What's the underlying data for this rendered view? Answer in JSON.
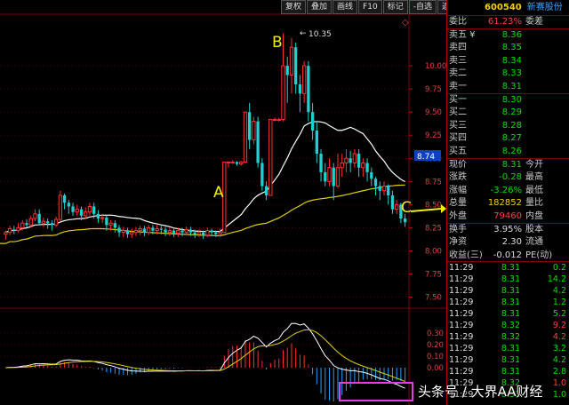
{
  "toolbar": {
    "buttons": [
      "复权",
      "叠加",
      "画线",
      "F10",
      "标记",
      "-自选",
      "返回"
    ],
    "close_symbol": "◇"
  },
  "stock": {
    "code": "600540",
    "name": "新赛股份"
  },
  "annotations": {
    "peak_price": "10.35",
    "label_a": "A",
    "label_b": "B",
    "label_c": "C",
    "current_price_tag": "8.74"
  },
  "price_axis": {
    "ticks": [
      "10.00",
      "9.75",
      "9.50",
      "9.25",
      "9.00",
      "8.75",
      "8.50",
      "8.25",
      "8.00",
      "7.75",
      "7.50"
    ]
  },
  "macd_axis": {
    "ticks": [
      "0.30",
      "0.20",
      "0.10",
      "0.00"
    ]
  },
  "order_book": {
    "ratio_label": "委比",
    "ratio_value": "61.23%",
    "diff_label": "委差",
    "asks": [
      {
        "label": "卖五 ¥",
        "price": "8.36"
      },
      {
        "label": "卖四",
        "price": "8.35"
      },
      {
        "label": "卖三",
        "price": "8.34"
      },
      {
        "label": "卖二",
        "price": "8.33"
      },
      {
        "label": "卖一",
        "price": "8.31"
      }
    ],
    "bids": [
      {
        "label": "买一",
        "price": "8.30"
      },
      {
        "label": "买二",
        "price": "8.29"
      },
      {
        "label": "买三",
        "price": "8.28"
      },
      {
        "label": "买四",
        "price": "8.27"
      },
      {
        "label": "买五",
        "price": "8.26"
      }
    ]
  },
  "quote": [
    {
      "label": "现价",
      "value": "8.31",
      "color": "green",
      "extra": "今开"
    },
    {
      "label": "涨跌",
      "value": "-0.28",
      "color": "green",
      "extra": "最高"
    },
    {
      "label": "涨幅",
      "value": "-3.26%",
      "color": "green",
      "extra": "最低"
    },
    {
      "label": "总量",
      "value": "182852",
      "color": "yellow",
      "extra": "量比"
    },
    {
      "label": "外盘",
      "value": "79460",
      "color": "red",
      "extra": "内盘"
    }
  ],
  "fundamentals": [
    {
      "label": "换手",
      "value": "3.95%",
      "extra": "股本"
    },
    {
      "label": "净资",
      "value": "2.30",
      "extra": "流通"
    },
    {
      "label": "收益(三)",
      "value": "-0.012",
      "extra": "PE(动)"
    }
  ],
  "ticks": [
    {
      "time": "11:29",
      "price": "8.31",
      "pcolor": "green",
      "vol": "0.2",
      "vcolor": "green"
    },
    {
      "time": "11:29",
      "price": "8.31",
      "pcolor": "green",
      "vol": "14.2",
      "vcolor": "green"
    },
    {
      "time": "11:29",
      "price": "8.31",
      "pcolor": "green",
      "vol": "4.2",
      "vcolor": "green"
    },
    {
      "time": "11:29",
      "price": "8.31",
      "pcolor": "green",
      "vol": "1.2",
      "vcolor": "green"
    },
    {
      "time": "11:29",
      "price": "8.31",
      "pcolor": "green",
      "vol": "5.2",
      "vcolor": "green"
    },
    {
      "time": "11:29",
      "price": "8.32",
      "pcolor": "green",
      "vol": "9.2",
      "vcolor": "red"
    },
    {
      "time": "11:29",
      "price": "8.32",
      "pcolor": "green",
      "vol": "4.2",
      "vcolor": "red"
    },
    {
      "time": "11:29",
      "price": "8.31",
      "pcolor": "green",
      "vol": "3.2",
      "vcolor": "green"
    },
    {
      "time": "11:29",
      "price": "8.31",
      "pcolor": "green",
      "vol": "4.2",
      "vcolor": "green"
    },
    {
      "time": "11:29",
      "price": "8.31",
      "pcolor": "green",
      "vol": "2.8",
      "vcolor": "green"
    },
    {
      "time": "11:29",
      "price": "8.32",
      "pcolor": "green",
      "vol": "1.0",
      "vcolor": "red"
    },
    {
      "time": "11:29",
      "price": "8.31",
      "pcolor": "green",
      "vol": "1.0",
      "vcolor": "green"
    }
  ],
  "watermark": "头条号 / 大界AA财经",
  "colors": {
    "up": "#ff3030",
    "down": "#20d0d0",
    "ma_short": "#ffffff",
    "ma_long": "#e0d000",
    "macd_up": "#ff3030",
    "macd_down": "#20a0ff",
    "highlight_box": "#e040e0",
    "grid": "#7a0000"
  },
  "chart_data": {
    "type": "candlestick",
    "ylim": [
      7.4,
      10.5
    ],
    "candles": [
      [
        8.18,
        8.2,
        8.12,
        8.22
      ],
      [
        8.2,
        8.24,
        8.17,
        8.27
      ],
      [
        8.23,
        8.22,
        8.18,
        8.27
      ],
      [
        8.22,
        8.25,
        8.2,
        8.3
      ],
      [
        8.25,
        8.3,
        8.22,
        8.33
      ],
      [
        8.3,
        8.28,
        8.25,
        8.34
      ],
      [
        8.28,
        8.35,
        8.25,
        8.38
      ],
      [
        8.35,
        8.4,
        8.32,
        8.45
      ],
      [
        8.4,
        8.3,
        8.28,
        8.45
      ],
      [
        8.3,
        8.32,
        8.26,
        8.36
      ],
      [
        8.32,
        8.3,
        8.24,
        8.35
      ],
      [
        8.3,
        8.28,
        8.22,
        8.33
      ],
      [
        8.28,
        8.34,
        8.26,
        8.37
      ],
      [
        8.34,
        8.6,
        8.32,
        8.65
      ],
      [
        8.6,
        8.52,
        8.45,
        8.62
      ],
      [
        8.52,
        8.48,
        8.4,
        8.55
      ],
      [
        8.48,
        8.42,
        8.38,
        8.52
      ],
      [
        8.42,
        8.45,
        8.38,
        8.5
      ],
      [
        8.45,
        8.38,
        8.33,
        8.48
      ],
      [
        8.38,
        8.42,
        8.35,
        8.47
      ],
      [
        8.42,
        8.48,
        8.38,
        8.52
      ],
      [
        8.48,
        8.4,
        8.35,
        8.52
      ],
      [
        8.4,
        8.35,
        8.3,
        8.44
      ],
      [
        8.35,
        8.36,
        8.3,
        8.4
      ],
      [
        8.36,
        8.28,
        8.22,
        8.38
      ],
      [
        8.28,
        8.3,
        8.22,
        8.33
      ],
      [
        8.3,
        8.25,
        8.2,
        8.33
      ],
      [
        8.25,
        8.2,
        8.15,
        8.28
      ],
      [
        8.2,
        8.22,
        8.15,
        8.26
      ],
      [
        8.22,
        8.18,
        8.14,
        8.25
      ],
      [
        8.18,
        8.2,
        8.14,
        8.24
      ],
      [
        8.2,
        8.22,
        8.16,
        8.26
      ],
      [
        8.22,
        8.24,
        8.17,
        8.27
      ],
      [
        8.24,
        8.2,
        8.16,
        8.27
      ],
      [
        8.2,
        8.25,
        8.17,
        8.28
      ],
      [
        8.25,
        8.22,
        8.18,
        8.28
      ],
      [
        8.22,
        8.24,
        8.18,
        8.28
      ],
      [
        8.24,
        8.23,
        8.18,
        8.27
      ],
      [
        8.23,
        8.2,
        8.16,
        8.26
      ],
      [
        8.2,
        8.22,
        8.16,
        8.25
      ],
      [
        8.22,
        8.19,
        8.15,
        8.25
      ],
      [
        8.19,
        8.22,
        8.15,
        8.25
      ],
      [
        8.22,
        8.2,
        8.16,
        8.25
      ],
      [
        8.2,
        8.23,
        8.17,
        8.26
      ],
      [
        8.23,
        8.2,
        8.16,
        8.26
      ],
      [
        8.2,
        8.18,
        8.14,
        8.23
      ],
      [
        8.18,
        8.2,
        8.15,
        8.23
      ],
      [
        8.2,
        8.17,
        8.13,
        8.22
      ],
      [
        8.17,
        8.22,
        8.15,
        8.25
      ],
      [
        8.22,
        8.2,
        8.16,
        8.24
      ],
      [
        8.2,
        8.18,
        8.15,
        8.22
      ],
      [
        8.18,
        8.2,
        8.15,
        8.24
      ],
      [
        8.2,
        8.96,
        8.2,
        8.96
      ],
      [
        8.96,
        8.96,
        8.9,
        8.96
      ],
      [
        8.96,
        8.96,
        8.94,
        8.98
      ],
      [
        8.96,
        8.94,
        8.92,
        8.97
      ],
      [
        8.94,
        8.96,
        8.92,
        8.97
      ],
      [
        8.96,
        9.5,
        8.95,
        9.5
      ],
      [
        9.5,
        9.2,
        9.1,
        9.6
      ],
      [
        9.2,
        9.4,
        9.15,
        9.45
      ],
      [
        9.4,
        8.95,
        8.9,
        9.45
      ],
      [
        8.95,
        8.7,
        8.65,
        9.0
      ],
      [
        8.7,
        8.6,
        8.55,
        8.75
      ],
      [
        8.6,
        9.42,
        8.6,
        9.42
      ],
      [
        9.42,
        9.42,
        9.4,
        9.44
      ],
      [
        9.42,
        9.42,
        9.4,
        9.44
      ],
      [
        9.42,
        10.0,
        9.4,
        10.35
      ],
      [
        10.0,
        9.9,
        9.6,
        10.1
      ],
      [
        9.9,
        10.2,
        9.7,
        10.3
      ],
      [
        10.2,
        9.8,
        9.7,
        10.25
      ],
      [
        9.8,
        9.7,
        9.5,
        9.9
      ],
      [
        9.7,
        10.0,
        9.6,
        10.05
      ],
      [
        10.0,
        9.5,
        9.4,
        10.05
      ],
      [
        9.5,
        9.3,
        9.2,
        9.6
      ],
      [
        9.3,
        9.05,
        8.95,
        9.4
      ],
      [
        9.05,
        8.85,
        8.75,
        9.1
      ],
      [
        8.85,
        8.75,
        8.7,
        8.95
      ],
      [
        8.75,
        8.9,
        8.7,
        9.0
      ],
      [
        8.9,
        8.7,
        8.55,
        8.95
      ],
      [
        8.7,
        8.9,
        8.68,
        9.05
      ],
      [
        8.9,
        8.95,
        8.8,
        9.05
      ],
      [
        8.95,
        9.0,
        8.85,
        9.1
      ],
      [
        9.0,
        8.95,
        8.85,
        9.08
      ],
      [
        8.95,
        9.05,
        8.9,
        9.1
      ],
      [
        9.05,
        8.9,
        8.8,
        9.1
      ],
      [
        8.9,
        8.95,
        8.8,
        9.0
      ],
      [
        8.95,
        8.85,
        8.75,
        9.0
      ],
      [
        8.85,
        8.78,
        8.7,
        8.9
      ],
      [
        8.78,
        8.7,
        8.6,
        8.8
      ],
      [
        8.7,
        8.65,
        8.55,
        8.75
      ],
      [
        8.65,
        8.7,
        8.6,
        8.75
      ],
      [
        8.7,
        8.6,
        8.5,
        8.72
      ],
      [
        8.6,
        8.45,
        8.4,
        8.65
      ],
      [
        8.45,
        8.5,
        8.4,
        8.55
      ],
      [
        8.5,
        8.35,
        8.3,
        8.52
      ],
      [
        8.35,
        8.31,
        8.26,
        8.4
      ]
    ]
  }
}
